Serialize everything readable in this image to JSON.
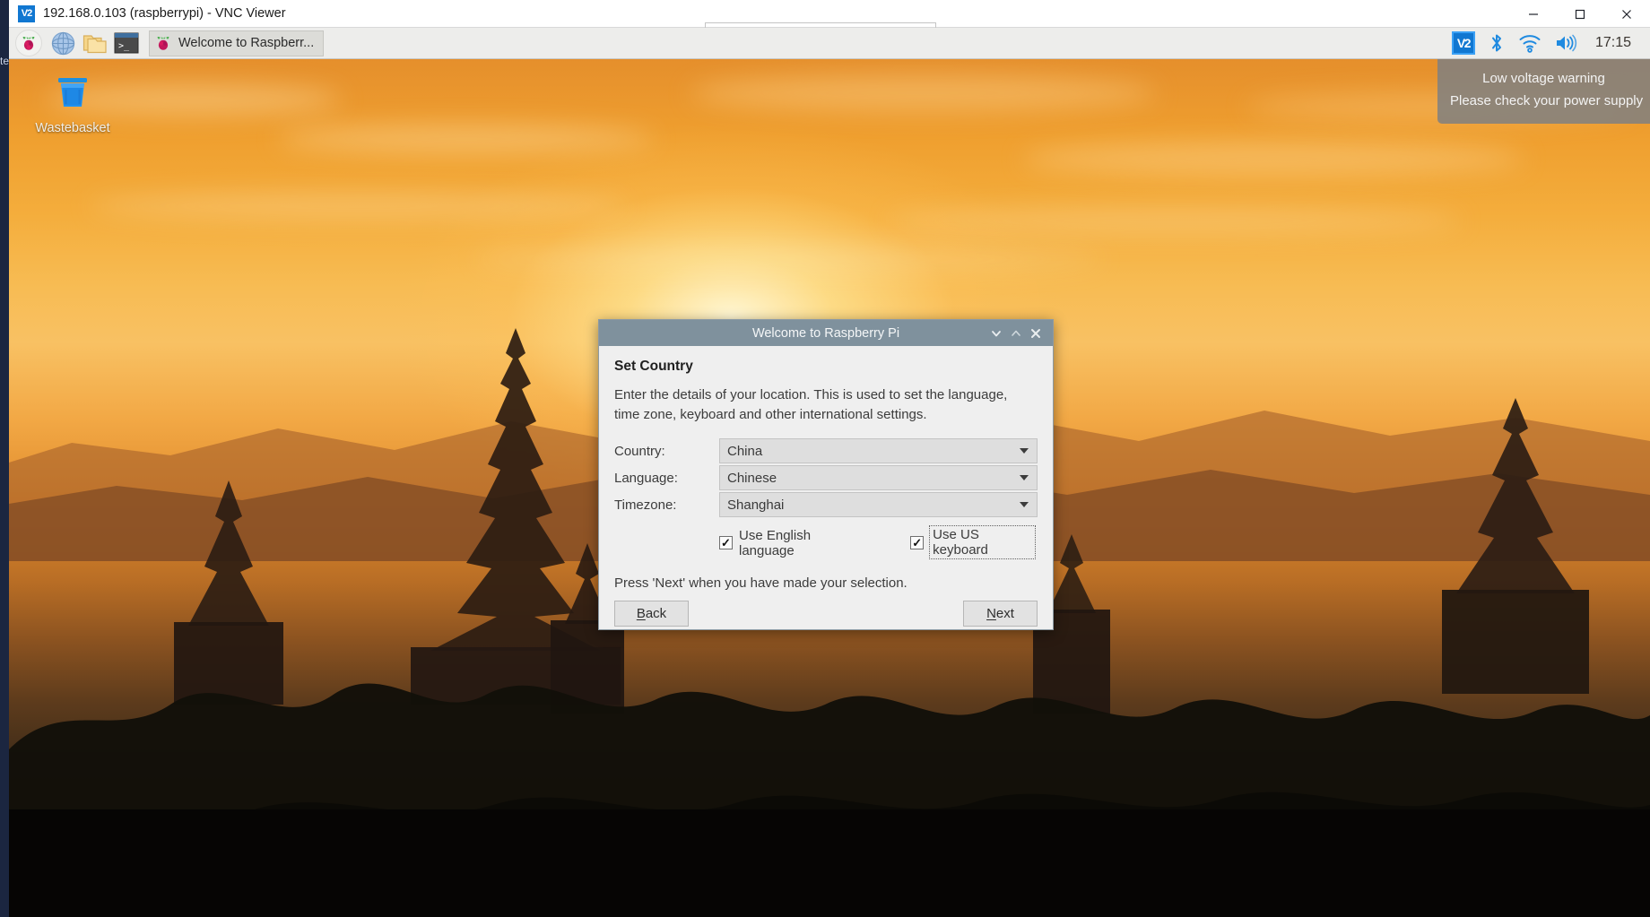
{
  "host_window": {
    "title": "192.168.0.103 (raspberrypi) - VNC Viewer",
    "icon": "vnc-logo-icon",
    "minimize_label": "minimize-icon",
    "maximize_label": "maximize-icon",
    "close_label": "close-icon",
    "edge_label": "te"
  },
  "taskbar": {
    "launchers": [
      {
        "name": "raspberry-menu-icon",
        "tooltip": "Menu"
      },
      {
        "name": "web-browser-icon",
        "tooltip": "Web Browser"
      },
      {
        "name": "file-manager-icon",
        "tooltip": "File Manager"
      },
      {
        "name": "terminal-icon",
        "tooltip": "Terminal"
      }
    ],
    "task_button": {
      "label": "Welcome to Raspberr...",
      "icon": "raspberry-icon"
    },
    "tray": {
      "vnc_icon": "vnc-server-icon",
      "vnc_badge": "V2",
      "bluetooth_icon": "bluetooth-icon",
      "wifi_icon": "wifi-icon",
      "volume_icon": "volume-icon",
      "clock": "17:15"
    }
  },
  "desktop": {
    "icons": [
      {
        "name": "wastebasket",
        "label": "Wastebasket",
        "icon": "trash-bin-icon"
      }
    ]
  },
  "notification": {
    "line1": "Low voltage warning",
    "line2": "Please check your power supply"
  },
  "dialog": {
    "title": "Welcome to Raspberry Pi",
    "window_buttons": {
      "shade": "chevron-down-icon",
      "unshade": "chevron-up-icon",
      "close": "close-icon"
    },
    "heading": "Set Country",
    "description": "Enter the details of your location. This is used to set the language, time zone, keyboard and other international settings.",
    "fields": [
      {
        "label": "Country:",
        "value": "China",
        "name": "country"
      },
      {
        "label": "Language:",
        "value": "Chinese",
        "name": "language"
      },
      {
        "label": "Timezone:",
        "value": "Shanghai",
        "name": "timezone"
      }
    ],
    "checkboxes": [
      {
        "label": "Use English language",
        "checked": true,
        "name": "use-english-language"
      },
      {
        "label": "Use US keyboard",
        "checked": true,
        "name": "use-us-keyboard",
        "focused": true
      }
    ],
    "footer_note": "Press 'Next' when you have made your selection.",
    "buttons": {
      "back": {
        "label": "Back",
        "accel": "B"
      },
      "next": {
        "label": "Next",
        "accel": "N"
      }
    }
  },
  "colors": {
    "dialog_titlebar": "#7f919d",
    "dialog_bg": "#efefef",
    "taskbar_bg": "#ededeb",
    "accent_blue": "#1177d1",
    "toast_bg": "rgba(128,128,128,0.86)"
  }
}
